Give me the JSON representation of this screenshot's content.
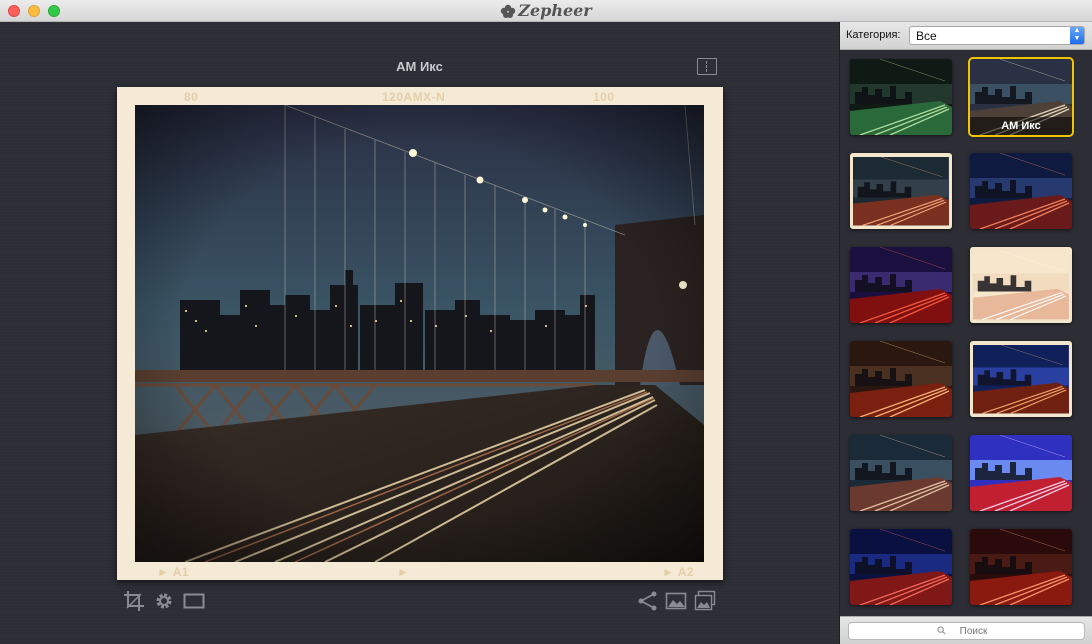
{
  "app": {
    "title": "Zepheer"
  },
  "preview": {
    "filter_name": "АМ Икс",
    "frame_labels": {
      "top_left": "80",
      "top_center": "120AMX-N",
      "top_right": "100",
      "bottom_left": "A1",
      "bottom_right": "A2"
    }
  },
  "toolbar": {
    "left_icons": [
      "crop-icon",
      "gear-icon",
      "border-frame-icon"
    ],
    "right_icons": [
      "share-icon",
      "image-icon",
      "images-stack-icon"
    ]
  },
  "sidebar": {
    "category_label": "Категория:",
    "category_value": "Все",
    "search_placeholder": "Поиск",
    "selected_label": "АМ Икс",
    "thumbnails": [
      {
        "style": "green-dark"
      },
      {
        "style": "cool-selected",
        "selected": true
      },
      {
        "style": "framed-warm"
      },
      {
        "style": "blue-red"
      },
      {
        "style": "purple-red"
      },
      {
        "style": "faded-cream"
      },
      {
        "style": "warm-sepia"
      },
      {
        "style": "blue-framed"
      },
      {
        "style": "cool-teal"
      },
      {
        "style": "vivid-blue"
      },
      {
        "style": "deep-blue"
      },
      {
        "style": "red-dark"
      }
    ]
  }
}
